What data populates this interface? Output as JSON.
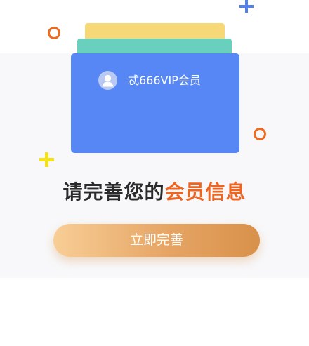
{
  "card": {
    "name": "忒666VIP会员",
    "avatar_icon": "user-avatar-icon"
  },
  "headline": {
    "part1": "请完善您的",
    "part2": "会员信息"
  },
  "cta": {
    "label": "立即完善"
  },
  "colors": {
    "card_front": "#5687f5",
    "card_mid": "#69d0be",
    "card_back": "#f7d877",
    "accent_orange": "#ee6421",
    "plus_blue": "#4f7ff0",
    "plus_yellow": "#f6e21b",
    "button_start": "#f8ce96",
    "button_end": "#d8914a"
  }
}
